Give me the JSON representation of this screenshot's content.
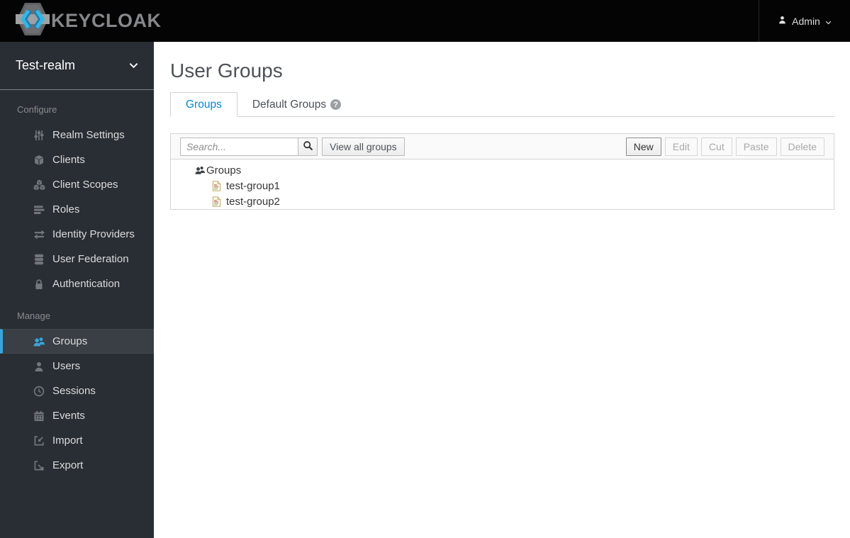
{
  "navbar": {
    "brand": "KEYCLOAK",
    "user_label": "Admin"
  },
  "sidebar": {
    "realm_name": "Test-realm",
    "sections": [
      {
        "title": "Configure",
        "items": [
          {
            "label": "Realm Settings",
            "icon": "sliders-icon"
          },
          {
            "label": "Clients",
            "icon": "cube-icon"
          },
          {
            "label": "Client Scopes",
            "icon": "cubes-icon"
          },
          {
            "label": "Roles",
            "icon": "list-icon"
          },
          {
            "label": "Identity Providers",
            "icon": "exchange-icon"
          },
          {
            "label": "User Federation",
            "icon": "database-icon"
          },
          {
            "label": "Authentication",
            "icon": "lock-icon"
          }
        ]
      },
      {
        "title": "Manage",
        "items": [
          {
            "label": "Groups",
            "icon": "users-icon",
            "active": true
          },
          {
            "label": "Users",
            "icon": "user-icon"
          },
          {
            "label": "Sessions",
            "icon": "clock-icon"
          },
          {
            "label": "Events",
            "icon": "calendar-icon"
          },
          {
            "label": "Import",
            "icon": "import-icon"
          },
          {
            "label": "Export",
            "icon": "export-icon"
          }
        ]
      }
    ]
  },
  "main": {
    "title": "User Groups",
    "tabs": [
      {
        "label": "Groups",
        "active": true
      },
      {
        "label": "Default Groups",
        "help": true
      }
    ],
    "toolbar": {
      "search_placeholder": "Search...",
      "search_value": "",
      "view_all_label": "View all groups",
      "actions": [
        {
          "label": "New",
          "enabled": true
        },
        {
          "label": "Edit",
          "enabled": false
        },
        {
          "label": "Cut",
          "enabled": false
        },
        {
          "label": "Paste",
          "enabled": false
        },
        {
          "label": "Delete",
          "enabled": false
        }
      ]
    },
    "tree": {
      "root_label": "Groups",
      "children": [
        "test-group1",
        "test-group2"
      ]
    }
  },
  "colors": {
    "navbar_bg": "#040404",
    "sidebar_bg": "#292e34",
    "sidebar_active_bg": "#393f44",
    "sidebar_active_border": "#39a5dc",
    "tab_active_text": "#0088ce",
    "title_text": "#4d5258",
    "logo_blue_light": "#35b6e5",
    "logo_blue_dark": "#1b7fb0"
  }
}
